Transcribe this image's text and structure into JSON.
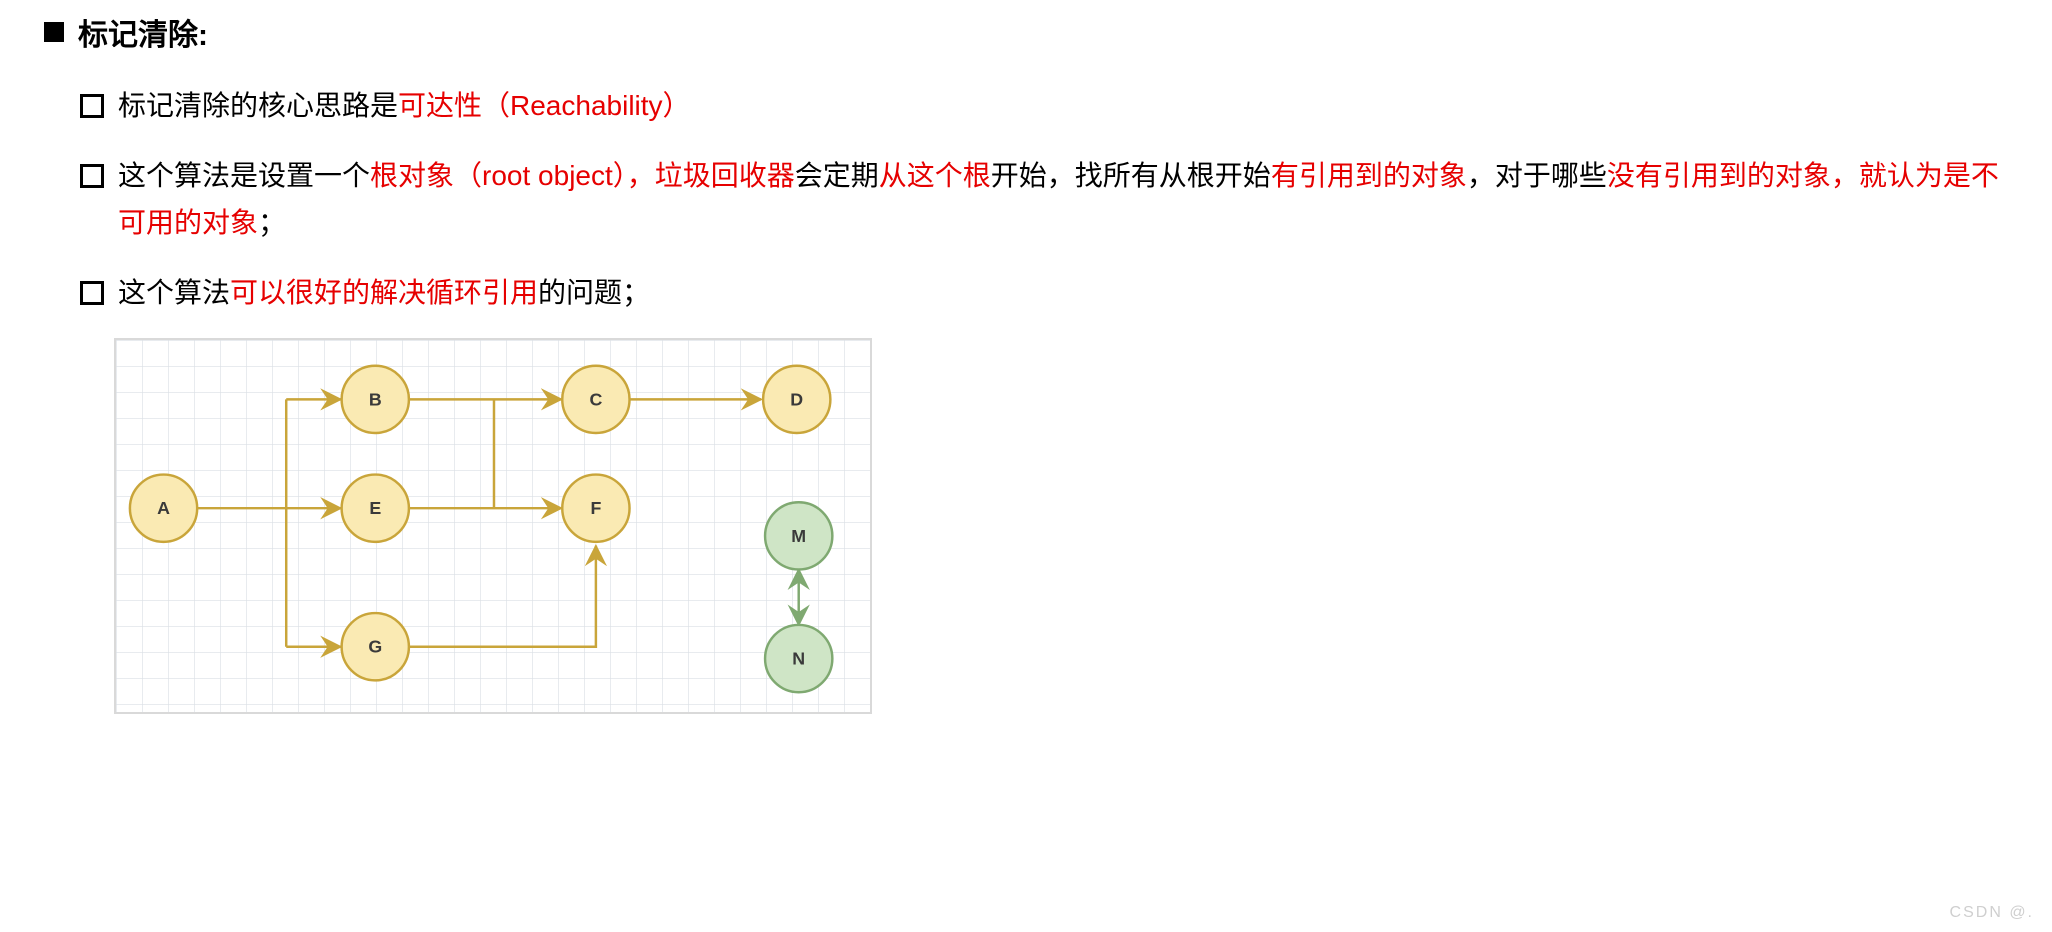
{
  "title": "标记清除:",
  "bullets": {
    "b1": {
      "t1": "标记清除的核心思路是",
      "t2": "可达性（Reachability）"
    },
    "b2": {
      "t1": "这个算法是设置一个",
      "t2": "根对象（root object），垃圾回收器",
      "t3": "会定期",
      "t4": "从这个根",
      "t5": "开始，找所有从根开始",
      "t6": "有引用到的对象",
      "t7": "，对于哪些",
      "t8": "没有引用到的对象，就认为是不可用的对象",
      "t9": "；"
    },
    "b3": {
      "t1": "这个算法",
      "t2": "可以很好的解决循环引用",
      "t3": "的问题；"
    }
  },
  "diagram": {
    "nodes": {
      "A": "A",
      "B": "B",
      "C": "C",
      "D": "D",
      "E": "E",
      "F": "F",
      "G": "G",
      "M": "M",
      "N": "N"
    },
    "yellow_fill": "#faeab3",
    "yellow_stroke": "#c9a53a",
    "green_fill": "#cfe5c6",
    "green_stroke": "#7fa971",
    "edge_stroke": "#c9a53a",
    "edge_green": "#7fa971"
  },
  "watermark": "CSDN @."
}
